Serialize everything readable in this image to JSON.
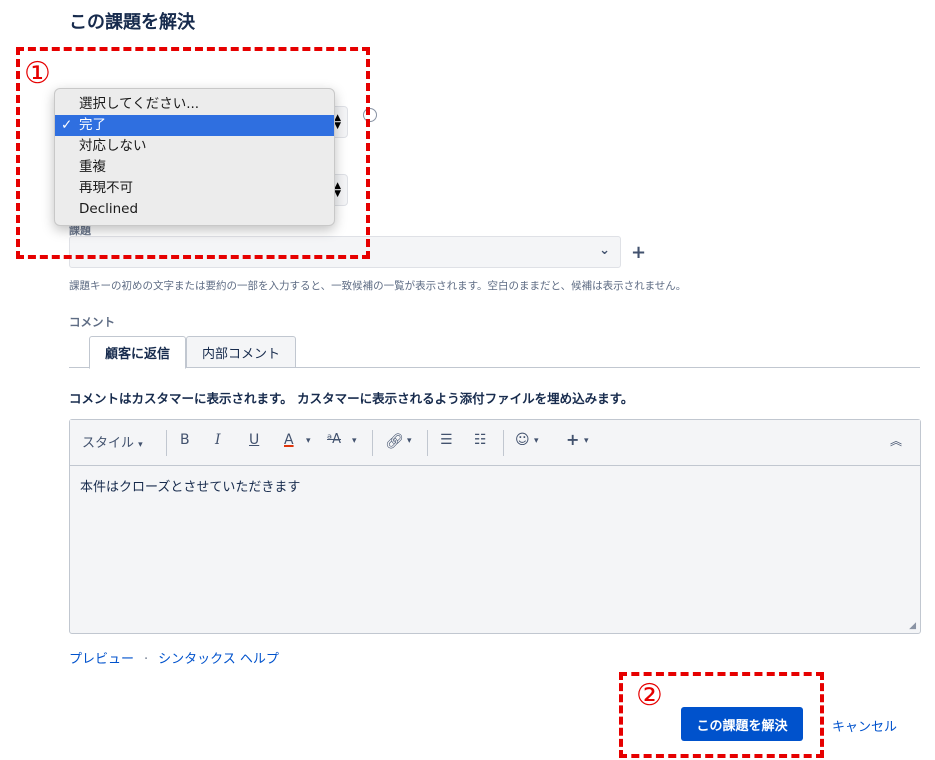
{
  "page": {
    "title": "この課題を解決"
  },
  "resolution_dropdown": {
    "options": [
      "選択してください...",
      "完了",
      "対応しない",
      "重複",
      "再現不可",
      "Declined"
    ],
    "selected_index": 1,
    "check_glyph": "✓"
  },
  "issue_field": {
    "label": "課題",
    "hint": "課題キーの初めの文字または要約の一部を入力すると、一致候補の一覧が表示されます。空白のままだと、候補は表示されません。"
  },
  "comment": {
    "label": "コメント",
    "tabs": [
      {
        "label": "顧客に返信",
        "active": true
      },
      {
        "label": "内部コメント",
        "active": false
      }
    ],
    "notice": "コメントはカスタマーに表示されます。 カスタマーに表示されるよう添付ファイルを埋め込みます。",
    "toolbar": {
      "style_label": "スタイル",
      "bold": "B",
      "italic": "I",
      "underline": "U",
      "text_color": "A",
      "more_format": "ᵃA"
    },
    "body_text": "本件はクローズとさせていただきます"
  },
  "footer_links": {
    "preview": "プレビュー",
    "separator": "·",
    "syntax_help": "シンタックス ヘルプ"
  },
  "actions": {
    "submit": "この課題を解決",
    "cancel": "キャンセル"
  },
  "annotations": {
    "one": "①",
    "two": "②"
  },
  "colors": {
    "primary": "#0052cc",
    "annotation": "#e60000",
    "selected_option": "#2f6fe0"
  }
}
